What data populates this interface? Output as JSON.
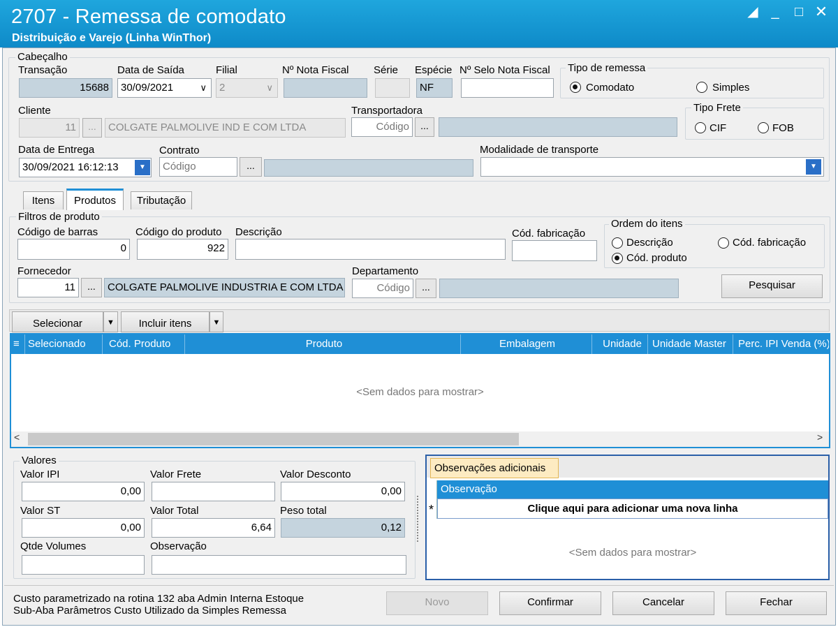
{
  "window": {
    "title": "2707 - Remessa de comodato",
    "subtitle": "Distribuição e Varejo (Linha WinThor)"
  },
  "header": {
    "group_label": "Cabeçalho",
    "transacao": {
      "label": "Transação",
      "value": "15688"
    },
    "data_saida": {
      "label": "Data de Saída",
      "value": "30/09/2021"
    },
    "filial": {
      "label": "Filial",
      "value": "2"
    },
    "nota_fiscal": {
      "label": "Nº Nota Fiscal",
      "value": ""
    },
    "serie": {
      "label": "Série",
      "value": ""
    },
    "especie": {
      "label": "Espécie",
      "value": "NF"
    },
    "selo": {
      "label": "Nº Selo Nota Fiscal",
      "value": ""
    },
    "tipo_remessa": {
      "label": "Tipo de remessa",
      "options": [
        "Comodato",
        "Simples"
      ],
      "selected": "Comodato"
    },
    "cliente": {
      "label": "Cliente",
      "code": "11",
      "name": "COLGATE PALMOLIVE IND E COM LTDA"
    },
    "transportadora": {
      "label": "Transportadora",
      "placeholder": "Código",
      "name": ""
    },
    "tipo_frete": {
      "label": "Tipo Frete",
      "options": [
        "CIF",
        "FOB"
      ],
      "selected": null
    },
    "data_entrega": {
      "label": "Data de Entrega",
      "value": "30/09/2021 16:12:13"
    },
    "contrato": {
      "label": "Contrato",
      "placeholder": "Código",
      "name": ""
    },
    "modalidade": {
      "label": "Modalidade de transporte",
      "value": ""
    }
  },
  "tabs": [
    {
      "label": "Itens",
      "active": false
    },
    {
      "label": "Produtos",
      "active": true
    },
    {
      "label": "Tributação",
      "active": false
    }
  ],
  "filters": {
    "group_label": "Filtros de produto",
    "codigo_barras": {
      "label": "Código de barras",
      "value": "0"
    },
    "codigo_produto": {
      "label": "Código do produto",
      "value": "922"
    },
    "descricao": {
      "label": "Descrição",
      "value": ""
    },
    "cod_fabricacao": {
      "label": "Cód. fabricação",
      "value": ""
    },
    "ordem": {
      "label": "Ordem do itens",
      "options": [
        "Descrição",
        "Cód. fabricação",
        "Cód. produto"
      ],
      "selected": "Cód. produto"
    },
    "fornecedor": {
      "label": "Fornecedor",
      "code": "11",
      "name": "COLGATE PALMOLIVE INDUSTRIA  E COM LTDA"
    },
    "departamento": {
      "label": "Departamento",
      "placeholder": "Código",
      "name": ""
    },
    "pesquisar": "Pesquisar"
  },
  "toolbar": {
    "selecionar": "Selecionar",
    "incluir": "Incluir itens"
  },
  "grid": {
    "columns": [
      "Selecionado",
      "Cód. Produto",
      "Produto",
      "Embalagem",
      "Unidade",
      "Unidade Master",
      "Perc. IPI Venda (%)"
    ],
    "empty": "<Sem dados para mostrar>"
  },
  "valores": {
    "group_label": "Valores",
    "valor_ipi": {
      "label": "Valor IPI",
      "value": "0,00"
    },
    "valor_frete": {
      "label": "Valor Frete",
      "value": ""
    },
    "valor_desconto": {
      "label": "Valor Desconto",
      "value": "0,00"
    },
    "valor_st": {
      "label": "Valor ST",
      "value": "0,00"
    },
    "valor_total": {
      "label": "Valor Total",
      "value": "6,64"
    },
    "peso_total": {
      "label": "Peso total",
      "value": "0,12"
    },
    "qtde_volumes": {
      "label": "Qtde Volumes",
      "value": ""
    },
    "observacao": {
      "label": "Observação",
      "value": ""
    }
  },
  "obs": {
    "tab": "Observações adicionais",
    "column": "Observação",
    "add_row": "Clique aqui para adicionar uma nova linha",
    "marker": "*",
    "empty": "<Sem dados para mostrar>"
  },
  "footer": {
    "note1": "Custo parametrizado na rotina 132 aba Admin Interna  Estoque",
    "note2": "Sub-Aba Parâmetros Custo Utilizado da Simples Remessa",
    "novo": "Novo",
    "confirmar": "Confirmar",
    "cancelar": "Cancelar",
    "fechar": "Fechar"
  }
}
